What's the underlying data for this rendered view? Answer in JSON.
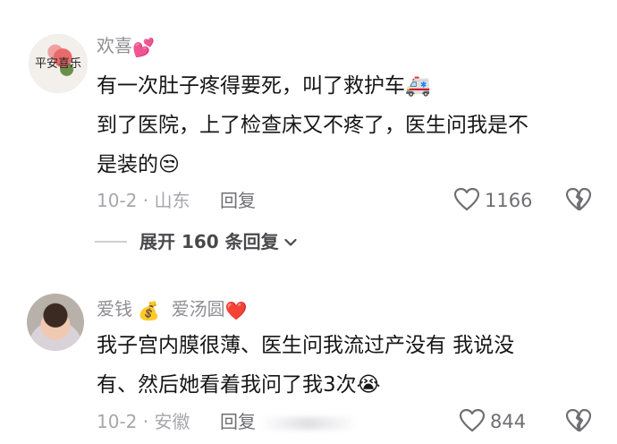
{
  "comments": [
    {
      "username": "欢喜",
      "username_emoji": "💕",
      "avatar_text": "平安喜乐",
      "lines": [
        "有一次肚子疼得要死，叫了救护车🚑",
        "到了医院，上了检查床又不疼了，医生问我是不",
        "是装的😒"
      ],
      "date_location": "10-2 · 山东",
      "reply_label": "回复",
      "like_count": "1166"
    },
    {
      "username": "爱钱",
      "username_emoji": "💰",
      "username_suffix": "爱汤圆",
      "username_suffix_emoji": "❤️",
      "lines": [
        "我子宫内膜很薄、医生问我流过产没有 我说没",
        "有、然后她看着我问了我3次😭"
      ],
      "date_location": "10-2 · 安徽",
      "reply_label": "回复",
      "like_count": "844"
    }
  ],
  "expand": {
    "label": "展开 160 条回复",
    "chevron": "chevron-down-icon"
  },
  "colors": {
    "text_primary": "#161616",
    "text_secondary": "#8e8e93",
    "icon": "#6f6f73"
  }
}
